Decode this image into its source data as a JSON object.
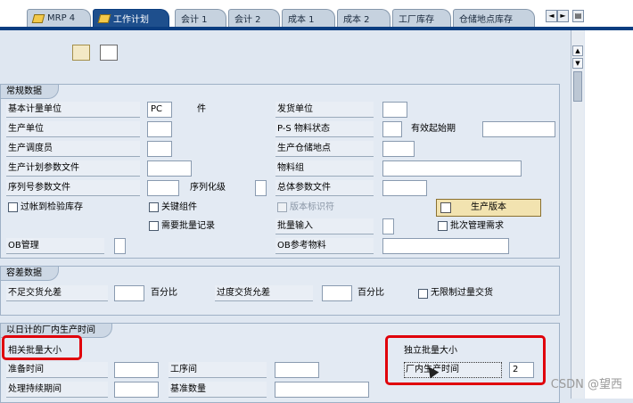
{
  "tabs": [
    "MRP 4",
    "工作计划",
    "会计 1",
    "会计 2",
    "成本 1",
    "成本 2",
    "工厂库存",
    "仓储地点库存"
  ],
  "active_tab": "工作计划",
  "tabnav": {
    "left": "◄",
    "right": "►",
    "menu": "▤"
  },
  "groups": {
    "general": "常规数据",
    "tolerance": "容差数据",
    "inhouse": "以日计的厂内生产时间"
  },
  "general": {
    "base_uom_label": "基本计量单位",
    "base_uom_value": "PC",
    "base_uom_unit": "件",
    "issue_unit_label": "发货单位",
    "prod_unit_label": "生产单位",
    "ps_status_label": "P-S 物料状态",
    "valid_from_label": "有效起始期",
    "prod_scheduler_label": "生产调度员",
    "prod_storage_label": "生产仓储地点",
    "prod_profile_label": "生产计划参数文件",
    "material_group_label": "物料组",
    "serial_profile_label": "序列号参数文件",
    "serialization_label": "序列化级",
    "overall_profile_label": "总体参数文件",
    "post_qi_label": "过帐到检验库存",
    "critical_comp_label": "关键组件",
    "version_indicator_label": "版本标识符",
    "prod_version_btn": "生产版本",
    "batch_record_label": "需要批量记录",
    "batch_entry_label": "批量输入",
    "batch_mgmt_label": "批次管理需求",
    "ob_mgmt_label": "OB管理",
    "ob_ref_label": "OB参考物料"
  },
  "tolerance": {
    "underdelivery_label": "不足交货允差",
    "percent1": "百分比",
    "overdelivery_label": "过度交货允差",
    "percent2": "百分比",
    "unlimited_label": "无限制过量交货"
  },
  "inhouse": {
    "lot_dependent_label": "相关批量大小",
    "lot_independent_label": "独立批量大小",
    "setup_time_label": "准备时间",
    "interoperation_label": "工序间",
    "inhouse_time_label": "厂内生产时间",
    "inhouse_time_value": "2",
    "processing_time_label": "处理持续期间",
    "base_qty_label": "基准数量"
  },
  "watermark": "CSDN @望西"
}
